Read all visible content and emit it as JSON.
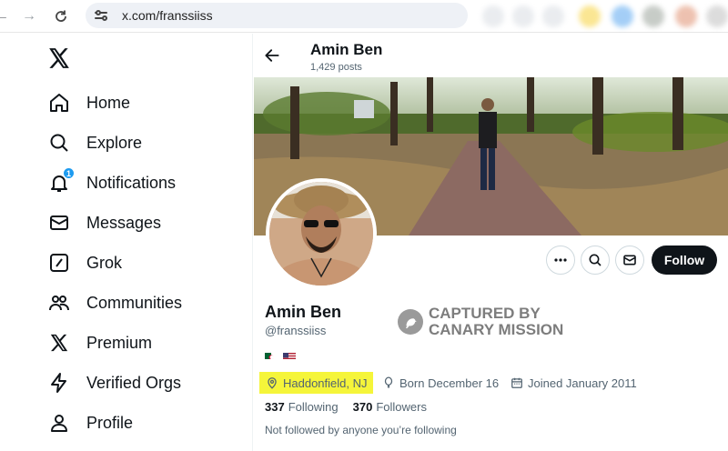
{
  "browser": {
    "url": "x.com/franssiiss",
    "extension_colors": [
      "#d9dde3",
      "#d9dde3",
      "#d9dde3",
      "#f7d23b",
      "#5aa7f0",
      "#9aa39a",
      "#e09070",
      "#c0c0c0"
    ]
  },
  "sidebar": {
    "items": [
      {
        "label": "Home",
        "icon": "home-icon"
      },
      {
        "label": "Explore",
        "icon": "search-icon"
      },
      {
        "label": "Notifications",
        "icon": "bell-icon",
        "badge": "1"
      },
      {
        "label": "Messages",
        "icon": "envelope-icon"
      },
      {
        "label": "Grok",
        "icon": "grok-icon"
      },
      {
        "label": "Communities",
        "icon": "people-icon"
      },
      {
        "label": "Premium",
        "icon": "x-logo-icon"
      },
      {
        "label": "Verified Orgs",
        "icon": "bolt-icon"
      },
      {
        "label": "Profile",
        "icon": "person-icon"
      }
    ]
  },
  "header": {
    "name": "Amin Ben",
    "posts": "1,429 posts"
  },
  "profile": {
    "name": "Amin Ben",
    "handle": "@franssiiss",
    "flags": [
      "algeria-flag",
      "us-flag"
    ],
    "location": "Haddonfield, NJ",
    "born": "Born December 16",
    "joined": "Joined January 2011",
    "following_count": "337",
    "following_label": "Following",
    "followers_count": "370",
    "followers_label": "Followers",
    "followed_by": "Not followed by anyone you’re following",
    "follow_label": "Follow",
    "location_highlight_color": "#f5f53a"
  },
  "watermark": {
    "line1": "CAPTURED BY",
    "line2": "CANARY MISSION"
  },
  "colors": {
    "text": "#0f1419",
    "muted": "#536471",
    "accent": "#1d9bf0",
    "follow_bg": "#0f1419"
  }
}
